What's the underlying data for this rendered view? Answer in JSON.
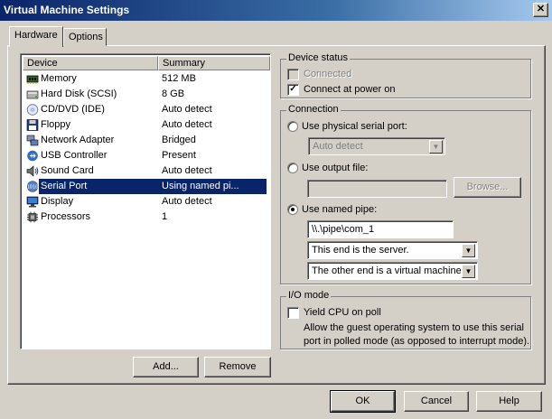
{
  "window": {
    "title": "Virtual Machine Settings",
    "close_glyph": "✕"
  },
  "tabs": [
    {
      "label": "Hardware"
    },
    {
      "label": "Options"
    }
  ],
  "device_list": {
    "headers": {
      "device": "Device",
      "summary": "Summary"
    },
    "rows": [
      {
        "name": "Memory",
        "summary": "512 MB",
        "icon": "memory-icon"
      },
      {
        "name": "Hard Disk (SCSI)",
        "summary": "8 GB",
        "icon": "hard-disk-icon"
      },
      {
        "name": "CD/DVD (IDE)",
        "summary": "Auto detect",
        "icon": "cd-dvd-icon"
      },
      {
        "name": "Floppy",
        "summary": "Auto detect",
        "icon": "floppy-icon"
      },
      {
        "name": "Network Adapter",
        "summary": "Bridged",
        "icon": "network-adapter-icon"
      },
      {
        "name": "USB Controller",
        "summary": "Present",
        "icon": "usb-icon"
      },
      {
        "name": "Sound Card",
        "summary": "Auto detect",
        "icon": "sound-card-icon"
      },
      {
        "name": "Serial Port",
        "summary": "Using named pi...",
        "icon": "serial-port-icon",
        "selected": true
      },
      {
        "name": "Display",
        "summary": "Auto detect",
        "icon": "display-icon"
      },
      {
        "name": "Processors",
        "summary": "1",
        "icon": "processor-icon"
      }
    ]
  },
  "list_buttons": {
    "add": "Add...",
    "remove": "Remove"
  },
  "device_status": {
    "title": "Device status",
    "connected": {
      "label": "Connected",
      "checked": false,
      "disabled": true
    },
    "connect_at_power_on": {
      "label": "Connect at power on",
      "checked": true
    }
  },
  "connection": {
    "title": "Connection",
    "physical": {
      "label": "Use physical serial port:",
      "selected": false,
      "value": "Auto detect"
    },
    "output_file": {
      "label": "Use output file:",
      "selected": false,
      "value": "",
      "browse_label": "Browse..."
    },
    "named_pipe": {
      "label": "Use named pipe:",
      "selected": true,
      "pipe_name": "\\\\.\\pipe\\com_1",
      "this_end": "This end is the server.",
      "other_end": "The other end is a virtual machine."
    }
  },
  "io_mode": {
    "title": "I/O mode",
    "yield_cpu": {
      "label": "Yield CPU on poll",
      "checked": false
    },
    "description_line1": "Allow the guest operating system to use this serial",
    "description_line2": "port in polled mode (as opposed to interrupt mode)."
  },
  "dialog_buttons": {
    "ok": "OK",
    "cancel": "Cancel",
    "help": "Help"
  },
  "colors": {
    "selection": "#0a246a",
    "face": "#d4d0c8",
    "title_start": "#0a246a",
    "title_end": "#a6caf0"
  }
}
